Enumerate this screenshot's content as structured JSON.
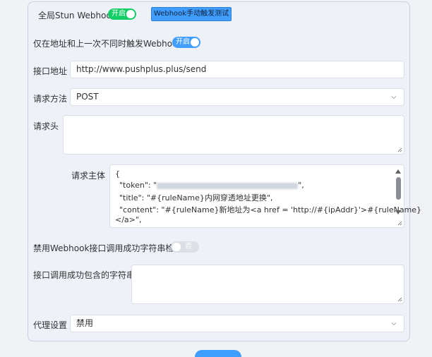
{
  "global_stun": {
    "label": "全局Stun Webhook",
    "switch_text": "开启"
  },
  "test_button": {
    "label": "Webhook手动触发测试"
  },
  "only_diff": {
    "label": "仅在地址和上一次不同时触发Webhook",
    "switch_text": "开启"
  },
  "api_url": {
    "label": "接口地址",
    "value": "http://www.pushplus.plus/send"
  },
  "method": {
    "label": "请求方法",
    "value": "POST"
  },
  "headers": {
    "label": "请求头",
    "value": ""
  },
  "body": {
    "label": "请求主体",
    "lines": [
      "{",
      "\"token\": \"",
      "\",",
      "\"title\": \"#{ruleName}内网穿透地址更换\",",
      "\"content\": \"#{ruleName}新地址为<a href = 'http://#{ipAddr}'>#{ruleName}",
      "</a>\","
    ]
  },
  "disable_check": {
    "label": "禁用Webhook接口调用成功字符串检测",
    "switch_text": "否"
  },
  "success_string": {
    "label": "接口调用成功包含的字符串",
    "value": ""
  },
  "proxy": {
    "label": "代理设置",
    "value": "禁用"
  },
  "colors": {
    "primary": "#409eff",
    "success": "#13ce66",
    "off": "#dcdfe6"
  }
}
